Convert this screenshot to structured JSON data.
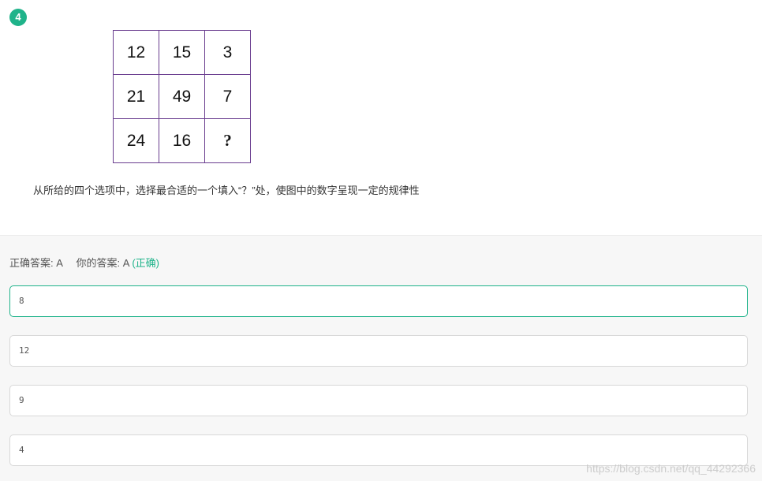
{
  "question": {
    "number": "4",
    "grid": [
      [
        "12",
        "15",
        "3"
      ],
      [
        "21",
        "49",
        "7"
      ],
      [
        "24",
        "16",
        "?"
      ]
    ],
    "text": "从所给的四个选项中，选择最合适的一个填入“？”处，使图中的数字呈现一定的规律性"
  },
  "result": {
    "correct_label": "正确答案:",
    "correct_value": "A",
    "your_label": "你的答案:",
    "your_value": "A",
    "status": "(正确)"
  },
  "options": [
    "8",
    "12",
    "9",
    "4"
  ],
  "watermark": "https://blog.csdn.net/qq_44292366",
  "colors": {
    "accent": "#1fb38a",
    "grid_border": "#6a3d8f"
  }
}
